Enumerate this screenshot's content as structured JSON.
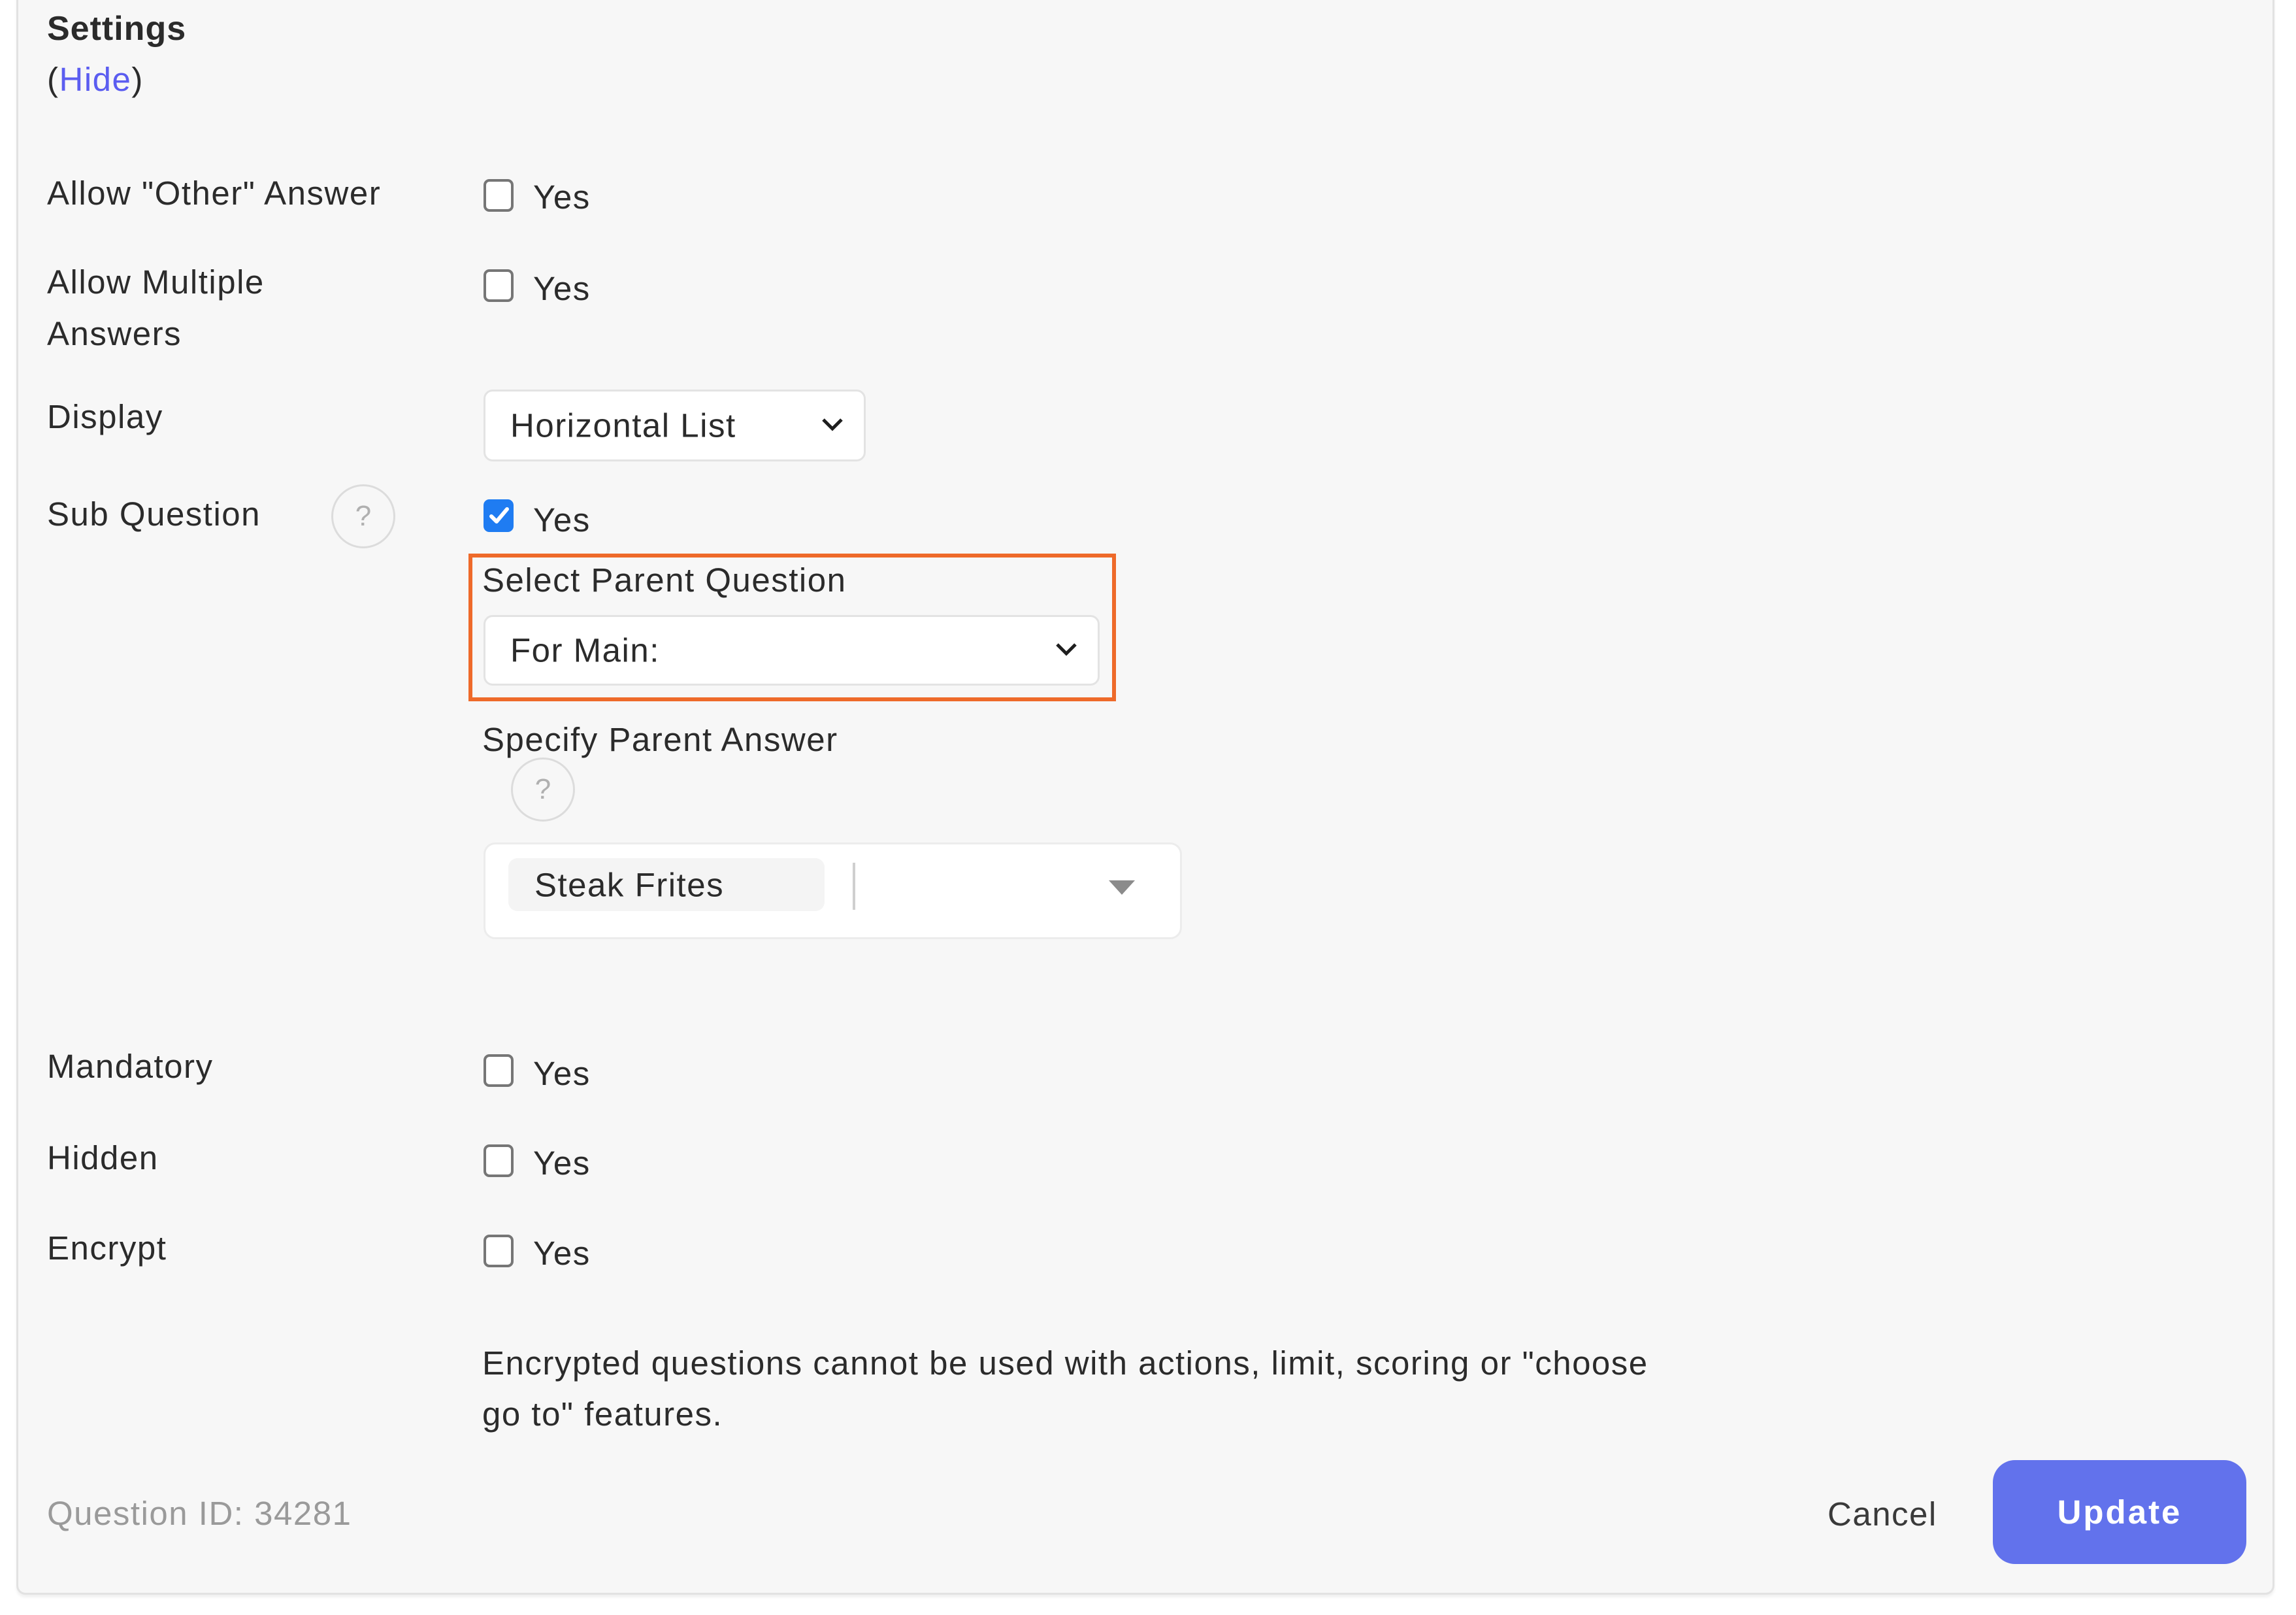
{
  "header": {
    "title": "Settings",
    "toggle_open_paren": "(",
    "toggle_link": "Hide",
    "toggle_close_paren": ")"
  },
  "fields": {
    "allow_other": {
      "label": "Allow \"Other\" Answer",
      "option_label": "Yes",
      "checked": false
    },
    "allow_multiple": {
      "label_line1": "Allow Multiple",
      "label_line2": "Answers",
      "option_label": "Yes",
      "checked": false
    },
    "display": {
      "label": "Display",
      "selected": "Horizontal List"
    },
    "sub_question": {
      "label": "Sub Question",
      "help_icon": "?",
      "option_label": "Yes",
      "checked": true,
      "parent_question_label": "Select Parent Question",
      "parent_question_selected": "For Main:",
      "parent_answer_label": "Specify Parent Answer",
      "parent_answer_help_icon": "?",
      "parent_answer_chips": [
        "Steak Frites"
      ]
    },
    "mandatory": {
      "label": "Mandatory",
      "option_label": "Yes",
      "checked": false
    },
    "hidden": {
      "label": "Hidden",
      "option_label": "Yes",
      "checked": false
    },
    "encrypt": {
      "label": "Encrypt",
      "option_label": "Yes",
      "checked": false,
      "note_line1": "Encrypted questions cannot be used with actions, limit, scoring or \"choose",
      "note_line2": "go to\" features."
    }
  },
  "footer": {
    "question_id": "Question ID: 34281",
    "cancel_label": "Cancel",
    "update_label": "Update"
  },
  "colors": {
    "accent": "#6272ec",
    "link": "#5b5df0",
    "checkbox_checked": "#1f7cf2",
    "highlight_border": "#ee6a2a",
    "panel_bg": "#f7f7f7"
  }
}
